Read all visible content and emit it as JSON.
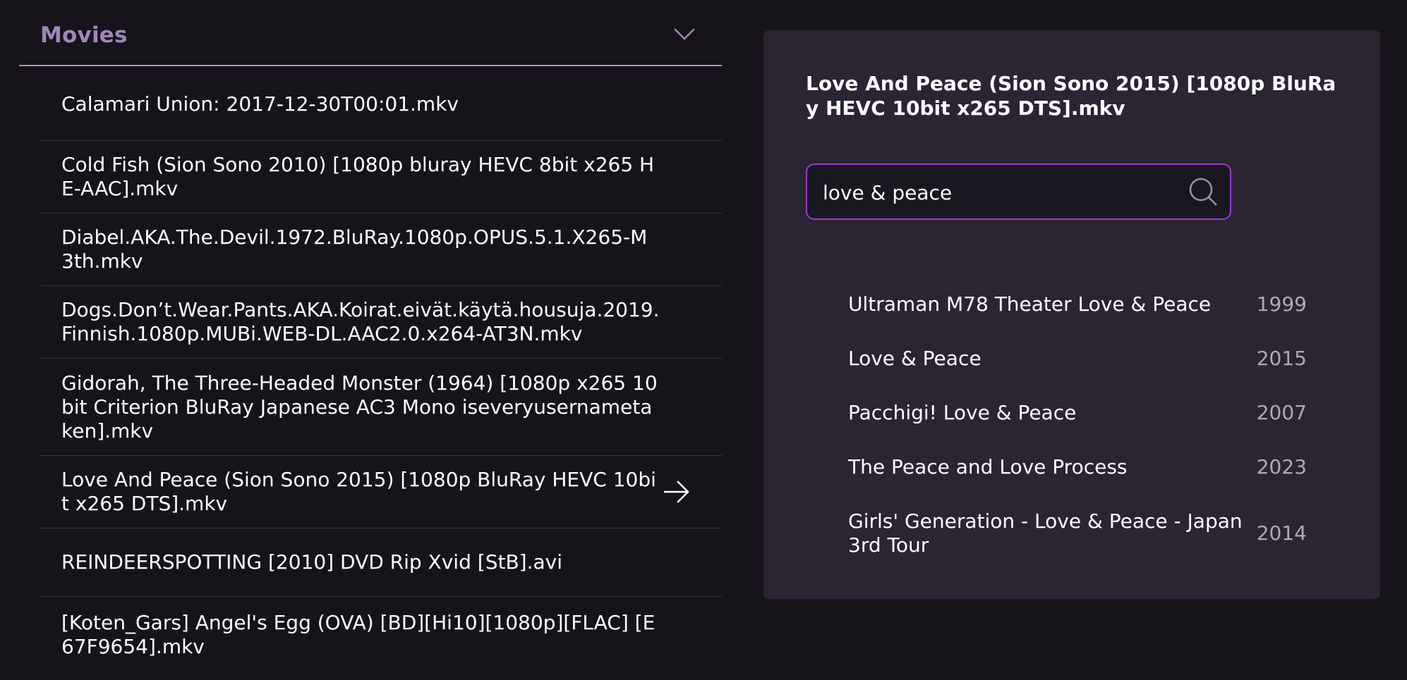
{
  "library": {
    "section_title": "Movies",
    "files": [
      {
        "name": "Calamari Union: 2017-12-30T00:01.mkv",
        "selected": false
      },
      {
        "name": "Cold Fish (Sion Sono 2010) [1080p bluray HEVC 8bit x265 HE-AAC].mkv",
        "selected": false
      },
      {
        "name": "Diabel.AKA.The.Devil.1972.BluRay.1080p.OPUS.5.1.X265-M3th.mkv",
        "selected": false
      },
      {
        "name": "Dogs.Don’t.Wear.Pants.AKA.Koirat.eivät.käytä.housuja.2019.Finnish.1080p.MUBi.WEB-DL.AAC2.0.x264-AT3N.mkv",
        "selected": false
      },
      {
        "name": "Gidorah, The Three-Headed Monster (1964) [1080p x265 10bit Criterion BluRay Japanese AC3 Mono iseveryusernametaken].mkv",
        "selected": false
      },
      {
        "name": "Love And Peace (Sion Sono 2015) [1080p BluRay HEVC 10bit x265 DTS].mkv",
        "selected": true
      },
      {
        "name": "REINDEERSPOTTING [2010] DVD Rip Xvid [StB].avi",
        "selected": false
      },
      {
        "name": "[Koten_Gars] Angel's Egg (OVA) [BD][Hi10][1080p][FLAC] [E67F9654].mkv",
        "selected": false
      }
    ]
  },
  "match_panel": {
    "file_title": "Love And Peace (Sion Sono 2015) [1080p BluRay HEVC 10bit x265 DTS].mkv",
    "search": {
      "value": "love & peace",
      "placeholder": ""
    },
    "results": [
      {
        "title": "Ultraman M78 Theater Love & Peace",
        "year": "1999"
      },
      {
        "title": "Love & Peace",
        "year": "2015"
      },
      {
        "title": "Pacchigi! Love & Peace",
        "year": "2007"
      },
      {
        "title": "The Peace and Love Process",
        "year": "2023"
      },
      {
        "title": "Girls' Generation - Love & Peace - Japan 3rd Tour",
        "year": "2014"
      }
    ]
  },
  "icons": {
    "section_toggle": "chevron-down-icon",
    "selected_file": "arrow-right-icon",
    "search": "search-icon"
  },
  "colors": {
    "background": "#17131a",
    "section_title": "#9d87b8",
    "panel": "#2b2433",
    "search_border": "#9b3ad6",
    "year_text": "#b0a9b5"
  }
}
